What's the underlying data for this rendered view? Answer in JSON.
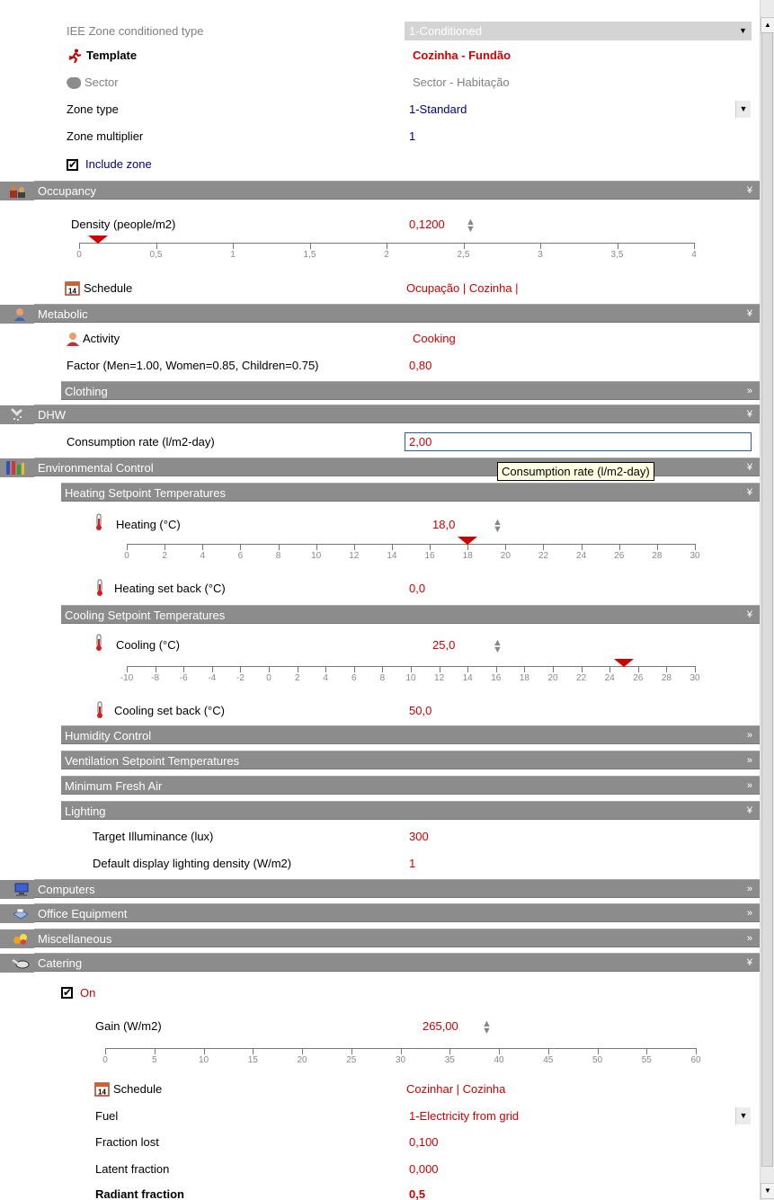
{
  "header": {
    "conditioned_type_label": "IEE Zone conditioned type",
    "conditioned_type_value": "1-Conditioned",
    "template_label": "Template",
    "template_value": "Cozinha - Fundão",
    "sector_label": "Sector",
    "sector_value": "Sector - Habitação",
    "zone_type_label": "Zone type",
    "zone_type_value": "1-Standard",
    "zone_multiplier_label": "Zone multiplier",
    "zone_multiplier_value": "1",
    "include_zone_label": "Include zone",
    "include_zone_checked": "✔"
  },
  "occupancy": {
    "title": "Occupancy",
    "density_label": "Density (people/m2)",
    "density_value": "0,1200",
    "density_ticks": [
      "0",
      "0,5",
      "1",
      "1,5",
      "2",
      "2,5",
      "3",
      "3,5",
      "4"
    ],
    "density_level": 0.12,
    "schedule_label": "Schedule",
    "schedule_value": "Ocupação | Cozinha |"
  },
  "metabolic": {
    "title": "Metabolic",
    "activity_label": "Activity",
    "activity_value": "Cooking",
    "factor_label": "Factor (Men=1.00, Women=0.85, Children=0.75)",
    "factor_value": "0,80",
    "clothing_title": "Clothing"
  },
  "dhw": {
    "title": "DHW",
    "consumption_label": "Consumption rate (l/m2-day)",
    "consumption_value": "2,00"
  },
  "tooltip": "Consumption rate (l/m2-day)",
  "environmental": {
    "title": "Environmental Control",
    "heating_title": "Heating Setpoint Temperatures",
    "heating_label": "Heating (°C)",
    "heating_value": "18,0",
    "heating_ticks": [
      "0",
      "2",
      "4",
      "6",
      "8",
      "10",
      "12",
      "14",
      "16",
      "18",
      "20",
      "22",
      "24",
      "26",
      "28",
      "30"
    ],
    "heating_level": 18,
    "heating_setback_label": "Heating set back (°C)",
    "heating_setback_value": "0,0",
    "cooling_title": "Cooling Setpoint Temperatures",
    "cooling_label": "Cooling (°C)",
    "cooling_value": "25,0",
    "cooling_ticks": [
      "-10",
      "-8",
      "-6",
      "-4",
      "-2",
      "0",
      "2",
      "4",
      "6",
      "8",
      "10",
      "12",
      "14",
      "16",
      "18",
      "20",
      "22",
      "24",
      "26",
      "28",
      "30"
    ],
    "cooling_level": 25,
    "cooling_setback_label": "Cooling set back (°C)",
    "cooling_setback_value": "50,0",
    "humidity_title": "Humidity Control",
    "ventilation_title": "Ventilation Setpoint Temperatures",
    "fresh_air_title": "Minimum Fresh Air",
    "lighting_title": "Lighting",
    "illuminance_label": "Target Illuminance (lux)",
    "illuminance_value": "300",
    "display_density_label": "Default display lighting density (W/m2)",
    "display_density_value": "1"
  },
  "computers": {
    "title": "Computers"
  },
  "office": {
    "title": "Office Equipment"
  },
  "misc": {
    "title": "Miscellaneous"
  },
  "catering": {
    "title": "Catering",
    "on_label": "On",
    "on_checked": "✔",
    "gain_label": "Gain (W/m2)",
    "gain_value": "265,00",
    "gain_ticks": [
      "0",
      "5",
      "10",
      "15",
      "20",
      "25",
      "30",
      "35",
      "40",
      "45",
      "50",
      "55",
      "60"
    ],
    "schedule_label": "Schedule",
    "schedule_value": "Cozinhar | Cozinha",
    "fuel_label": "Fuel",
    "fuel_value": "1-Electricity from grid",
    "fraction_lost_label": "Fraction lost",
    "fraction_lost_value": "0,100",
    "latent_label": "Latent fraction",
    "latent_value": "0,000",
    "radiant_label": "Radiant fraction",
    "radiant_value": "0,5"
  },
  "chevrons": {
    "open": "»",
    "closed": "»"
  },
  "colors": {
    "section_bg": "#8c8c8c",
    "value_red": "#d00000",
    "value_blue": "#000080"
  }
}
